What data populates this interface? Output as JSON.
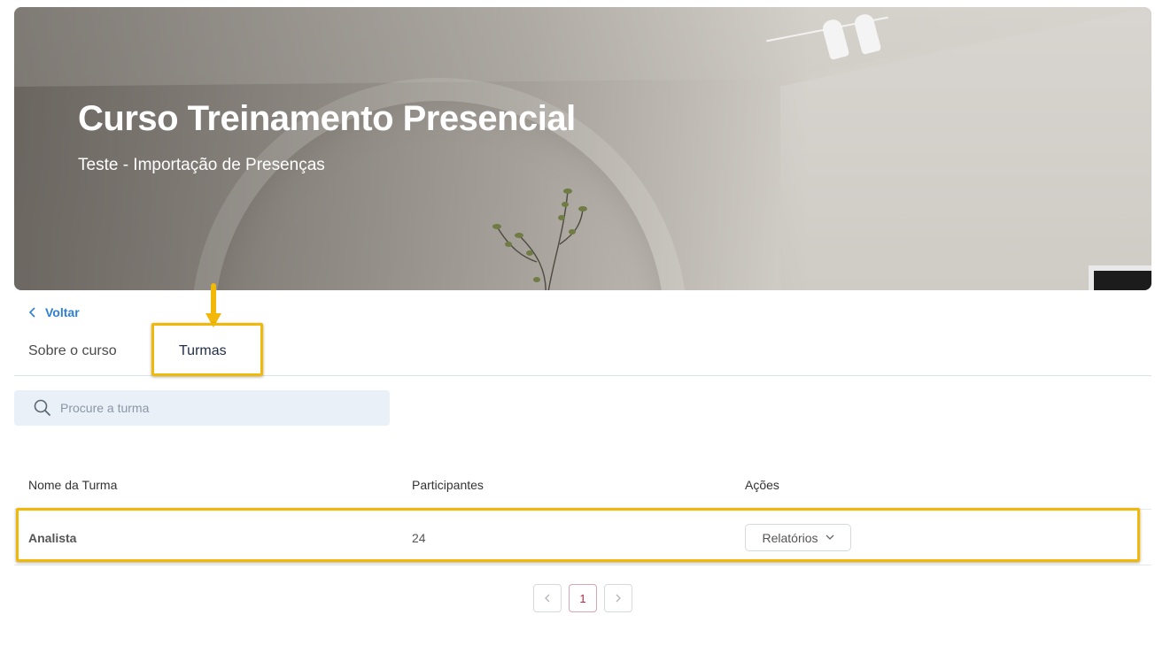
{
  "hero": {
    "title": "Curso Treinamento Presencial",
    "subtitle": "Teste - Importação de Presenças"
  },
  "nav": {
    "back_label": "Voltar",
    "tabs": [
      {
        "label": "Sobre o curso",
        "active": false
      },
      {
        "label": "Turmas",
        "active": true
      }
    ]
  },
  "search": {
    "placeholder": "Procure a turma",
    "value": ""
  },
  "table": {
    "columns": [
      "Nome da Turma",
      "Participantes",
      "Ações"
    ],
    "rows": [
      {
        "name": "Analista",
        "participants": "24",
        "action_label": "Relatórios"
      }
    ]
  },
  "pagination": {
    "prev_icon": "chevron-left-icon",
    "pages": [
      "1"
    ],
    "current_page": "1",
    "next_icon": "chevron-right-icon"
  },
  "colors": {
    "accent": "#2f7fd6",
    "highlight": "#f2b807",
    "current_page": "#c0243f"
  }
}
